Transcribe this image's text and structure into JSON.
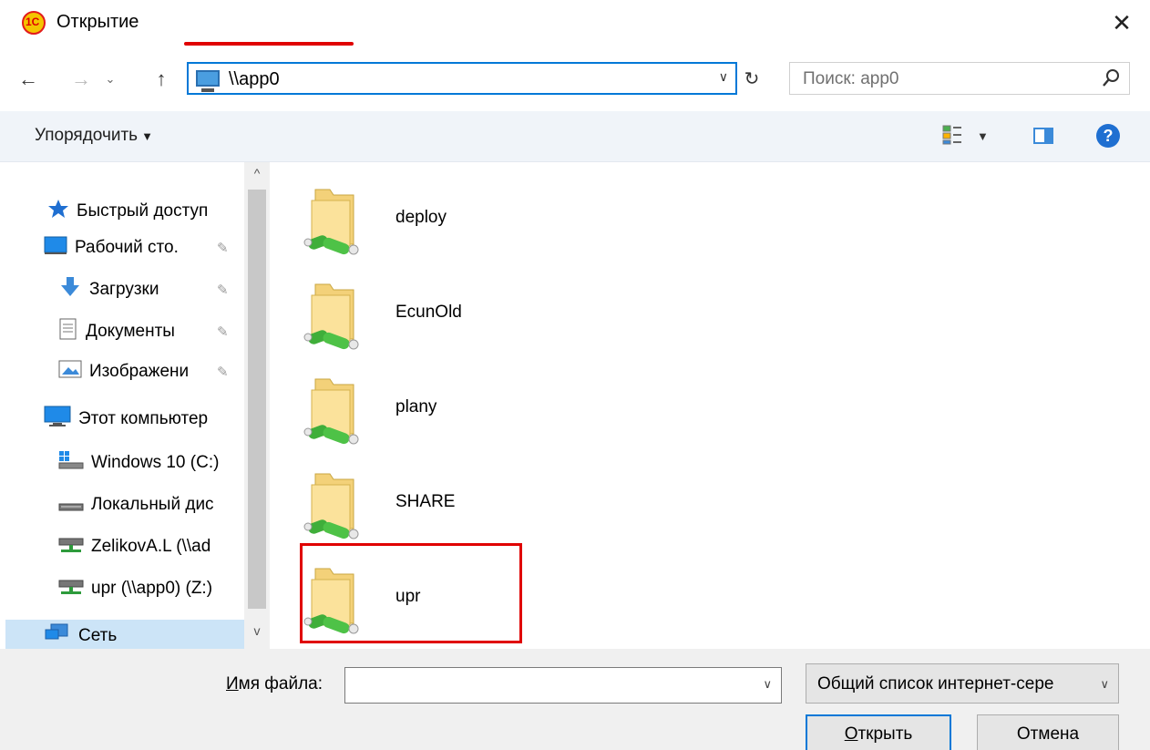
{
  "window": {
    "title": "Открытие",
    "close_glyph": "✕"
  },
  "navigation": {
    "back_glyph": "←",
    "forward_glyph": "→",
    "recent_glyph": "⌄",
    "up_glyph": "↑",
    "address": "\\\\app0",
    "refresh_glyph": "↻",
    "search_placeholder": "Поиск: app0"
  },
  "toolbar": {
    "organize_label": "Упорядочить",
    "help_glyph": "?"
  },
  "sidebar": {
    "items": [
      {
        "label": "Быстрый доступ",
        "icon": "star-icon"
      },
      {
        "label": "Рабочий сто.",
        "icon": "desktop-icon",
        "pinned": true
      },
      {
        "label": "Загрузки",
        "icon": "download-icon",
        "pinned": true
      },
      {
        "label": "Документы",
        "icon": "documents-icon",
        "pinned": true
      },
      {
        "label": "Изображени",
        "icon": "pictures-icon",
        "pinned": true
      },
      {
        "label": "Этот компьютер",
        "icon": "computer-icon"
      },
      {
        "label": "Windows 10 (C:)",
        "icon": "windows-drive-icon"
      },
      {
        "label": "Локальный дис",
        "icon": "drive-icon"
      },
      {
        "label": "ZelikovA.L (\\\\ad",
        "icon": "network-drive-icon"
      },
      {
        "label": "upr (\\\\app0) (Z:)",
        "icon": "network-drive-icon"
      },
      {
        "label": "Сеть",
        "icon": "network-icon",
        "selected": true
      }
    ]
  },
  "folders": [
    {
      "name": "deploy"
    },
    {
      "name": "EcunOld"
    },
    {
      "name": "plany"
    },
    {
      "name": "SHARE"
    },
    {
      "name": "upr",
      "highlighted": true
    }
  ],
  "footer": {
    "filename_label_accel": "И",
    "filename_label_rest": "мя файла:",
    "filename_value": "",
    "filter_value": "Общий список интернет-сере",
    "open_accel": "О",
    "open_rest": "ткрыть",
    "cancel_label": "Отмена"
  },
  "colors": {
    "accent": "#0078d7",
    "annotation_red": "#e00000",
    "selection": "#cce4f7"
  }
}
